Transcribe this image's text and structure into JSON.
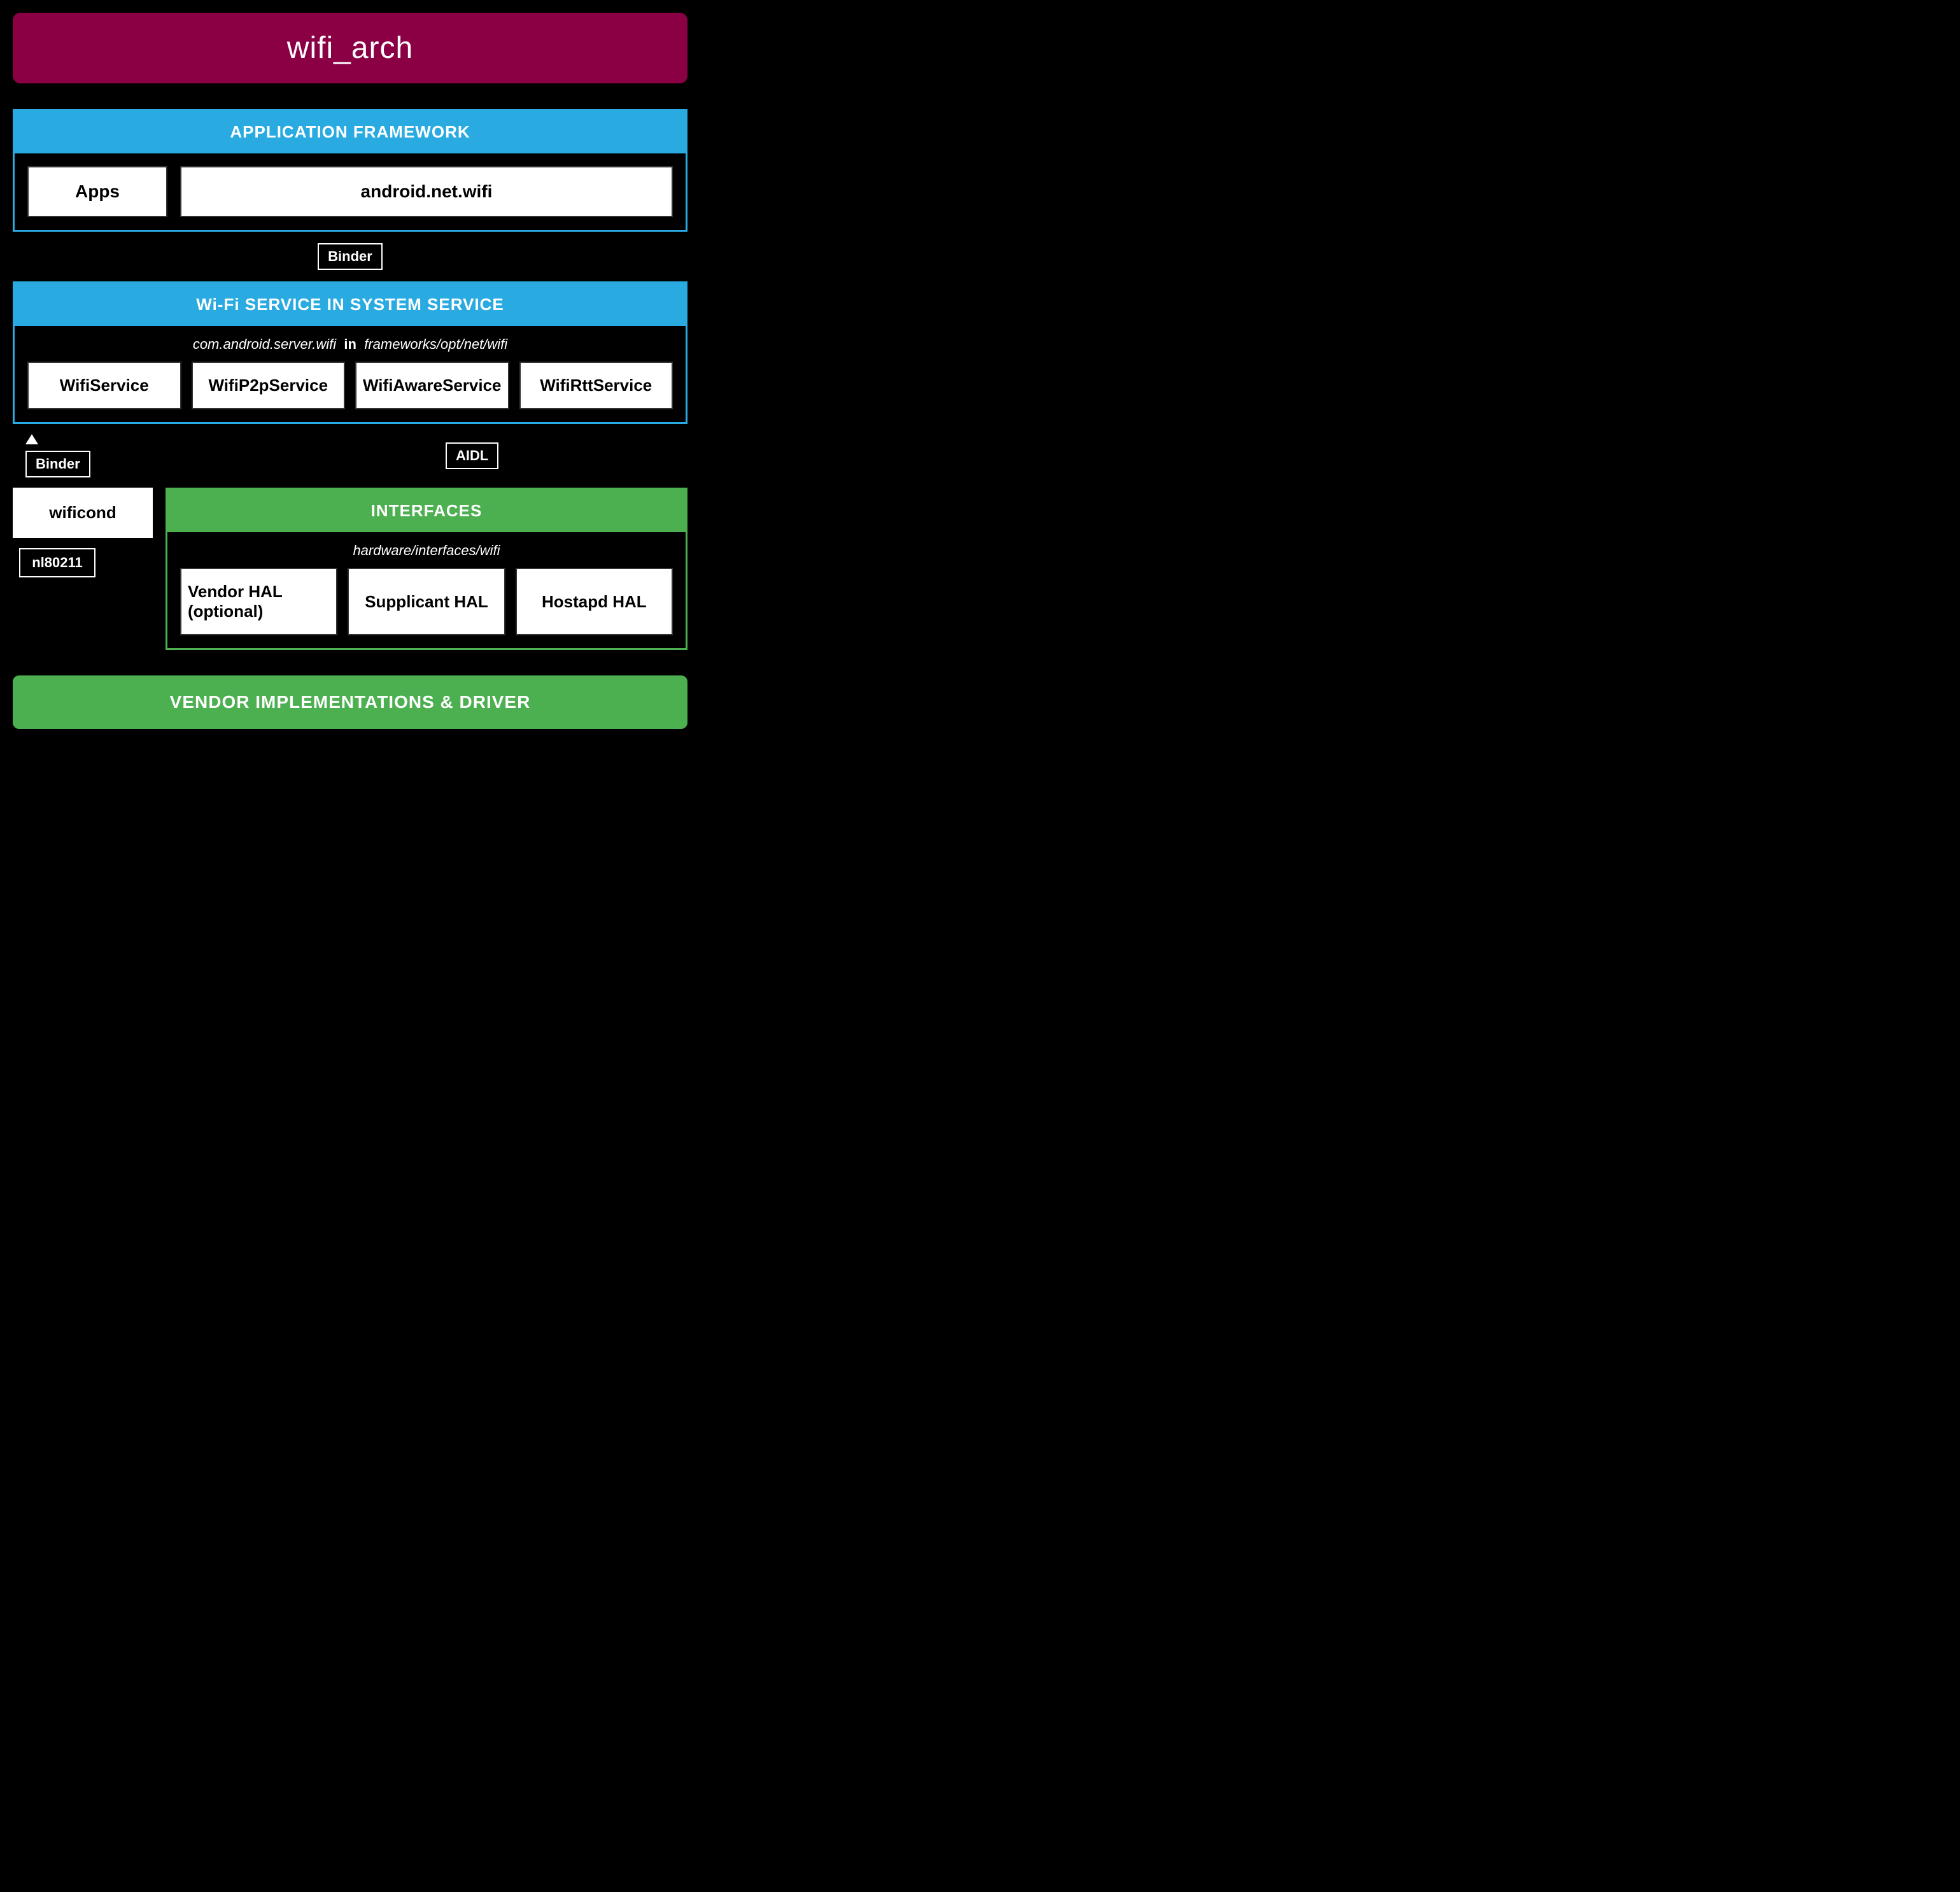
{
  "title": "wifi_arch",
  "title_bar_bg": "#8b0045",
  "app_framework": {
    "header": "APPLICATION FRAMEWORK",
    "apps_label": "Apps",
    "android_net_wifi_label": "android.net.wifi"
  },
  "binder_top": "Binder",
  "wifi_service": {
    "header": "Wi-Fi SERVICE IN SYSTEM SERVICE",
    "subtitle_italic": "com.android.server.wifi",
    "subtitle_bold": "in",
    "subtitle_italic2": "frameworks/opt/net/wifi",
    "services": [
      {
        "label": "WifiService"
      },
      {
        "label": "WifiP2pService"
      },
      {
        "label": "WifiAwareService"
      },
      {
        "label": "WifiRttService"
      }
    ]
  },
  "binder_left": "Binder",
  "aidl_label": "AIDL",
  "wificond_label": "wificond",
  "interfaces": {
    "header": "INTERFACES",
    "subtitle": "hardware/interfaces/wifi",
    "items": [
      {
        "label": "Vendor HAL (optional)"
      },
      {
        "label": "Supplicant HAL"
      },
      {
        "label": "Hostapd HAL"
      }
    ]
  },
  "nl80211_label": "nl80211",
  "vendor_bar": "VENDOR IMPLEMENTATIONS & DRIVER"
}
